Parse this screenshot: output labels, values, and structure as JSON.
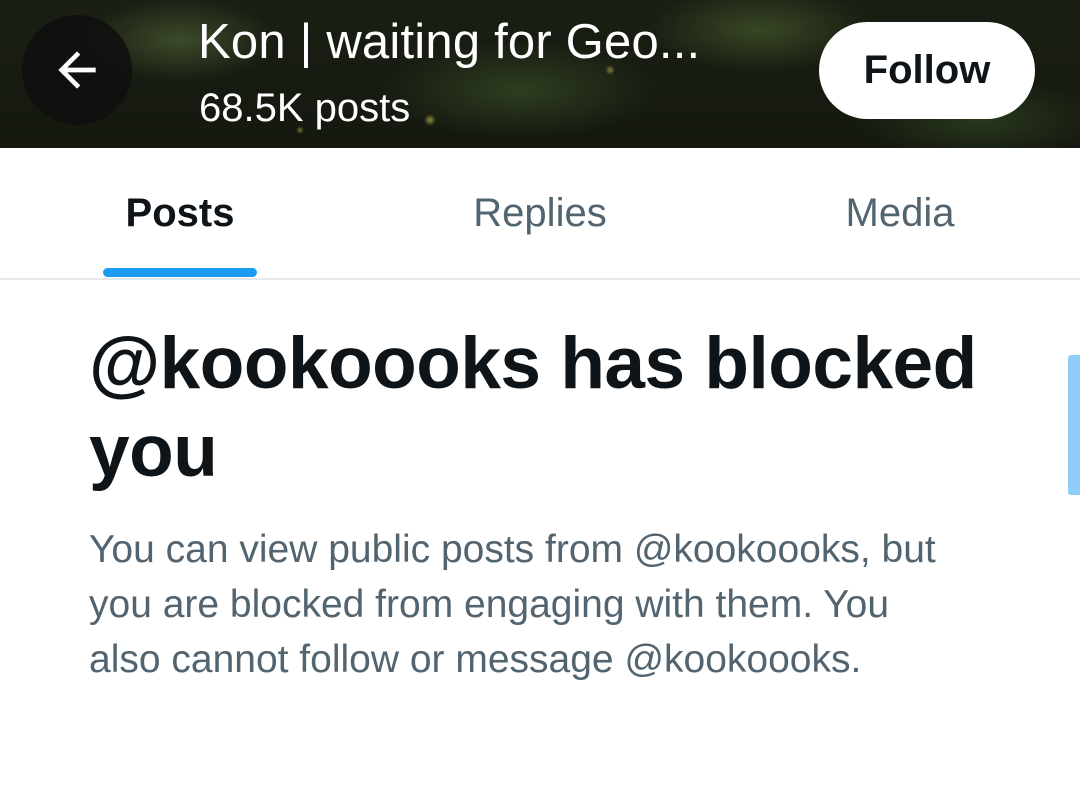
{
  "header": {
    "title": "Kon | waiting for Geo...",
    "post_count": "68.5K posts",
    "follow_label": "Follow",
    "back_icon": "arrow-left-icon"
  },
  "tabs": [
    {
      "label": "Posts",
      "active": true
    },
    {
      "label": "Replies",
      "active": false
    },
    {
      "label": "Media",
      "active": false
    }
  ],
  "blocked": {
    "title": "@kookoooks has blocked you",
    "description": "You can view public posts from @kookoooks, but you are blocked from engaging with them. You also cannot follow or message @kookoooks."
  },
  "colors": {
    "accent": "#1d9bf0",
    "text_primary": "#0f1419",
    "text_secondary": "#536471"
  }
}
